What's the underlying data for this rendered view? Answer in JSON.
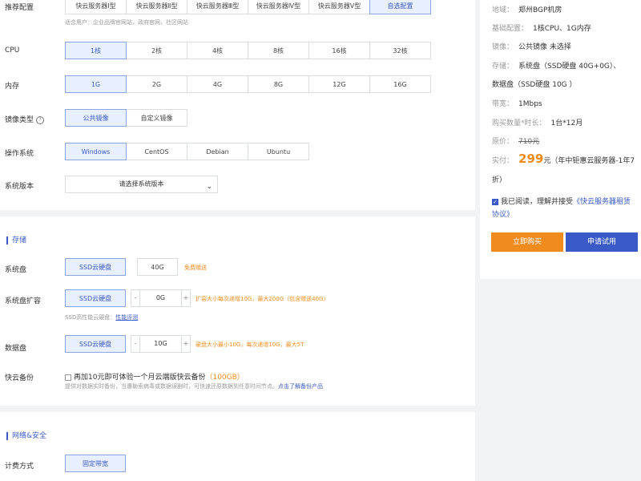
{
  "config": {
    "recommend": {
      "label": "推荐配置",
      "options": [
        "快云服务器Ⅰ型",
        "快云服务器Ⅱ型",
        "快云服务器Ⅲ型",
        "快云服务器Ⅳ型",
        "快云服务器Ⅴ型",
        "自选配置"
      ],
      "selected": 5,
      "hint": "适合用户：企业品牌官网站，政府官网，社区网站"
    },
    "cpu": {
      "label": "CPU",
      "options": [
        "1核",
        "2核",
        "4核",
        "8核",
        "16核",
        "32核"
      ],
      "selected": 0
    },
    "memory": {
      "label": "内存",
      "options": [
        "1G",
        "2G",
        "4G",
        "8G",
        "12G",
        "16G"
      ],
      "selected": 0
    },
    "image_type": {
      "label": "镜像类型",
      "help_icon": "question-circle-icon",
      "options": [
        "公共镜像",
        "自定义镜像"
      ],
      "selected": 0
    },
    "os": {
      "label": "操作系统",
      "options": [
        "Windows",
        "CentOS",
        "Debian",
        "Ubuntu"
      ],
      "selected": 0
    },
    "os_version": {
      "label": "系统版本",
      "placeholder": "请选择系统版本",
      "chevron": "chevron-down-icon"
    }
  },
  "storage": {
    "title": "存储",
    "system_disk": {
      "label": "系统盘",
      "type": "SSD云硬盘",
      "size": "40G",
      "note": "免费赠送"
    },
    "system_expand": {
      "label": "系统盘扩容",
      "type": "SSD云硬盘",
      "minus": "-",
      "value": "0G",
      "plus": "+",
      "note": "扩容大小每次递增10G，最大200G（包含赠送40G）",
      "perf_prefix": "SSD高性能云硬盘：",
      "perf_link": "性能评测"
    },
    "data_disk": {
      "label": "数据盘",
      "type": "SSD云硬盘",
      "minus": "-",
      "value": "10G",
      "plus": "+",
      "note": "硬盘大小最小10G，每次递增10G，最大5T"
    },
    "backup": {
      "label": "快云备份",
      "checkbox_text": "再加10元即可体验一个月云端版快云备份",
      "highlight": "（100GB）",
      "desc": "提供对数据实时备份，当遭勒索病毒或数据误删时，可快速还原数据到任意时间节点。",
      "link": "点击了解备份产品"
    }
  },
  "network": {
    "title": "网络&安全",
    "billing": {
      "label": "计费方式",
      "option": "固定带宽"
    }
  },
  "summary": {
    "rows": [
      {
        "key": "地域：",
        "value": "郑州BGP机房"
      },
      {
        "key": "基础配置：",
        "value": "1核CPU、1G内存"
      },
      {
        "key": "镜像：",
        "value": "公共镜像 未选择"
      },
      {
        "key": "存储：",
        "value": "系统盘（SSD硬盘 40G+0G）、"
      }
    ],
    "storage_line2": "数据盘（SSD硬盘 10G ）",
    "bandwidth": {
      "key": "带宽：",
      "value": "1Mbps"
    },
    "quantity": {
      "key": "购买数量*时长：",
      "value": "1台*12月"
    },
    "original_price": {
      "key": "原价：",
      "value": "710元"
    },
    "actual_price": {
      "key": "实付：",
      "amount": "299",
      "unit": "元",
      "note": "（年中钜惠云服务器-1年7"
    },
    "actual_note_2": "折）",
    "agree_text": "我已阅读，理解并接受",
    "agree_link": "《快云服务器租赁协议》",
    "buy_label": "立即购买",
    "trial_label": "申请试用"
  },
  "colors": {
    "accent": "#3a5bc7",
    "orange": "#f08c1e",
    "selected_bg": "#e8efff"
  }
}
